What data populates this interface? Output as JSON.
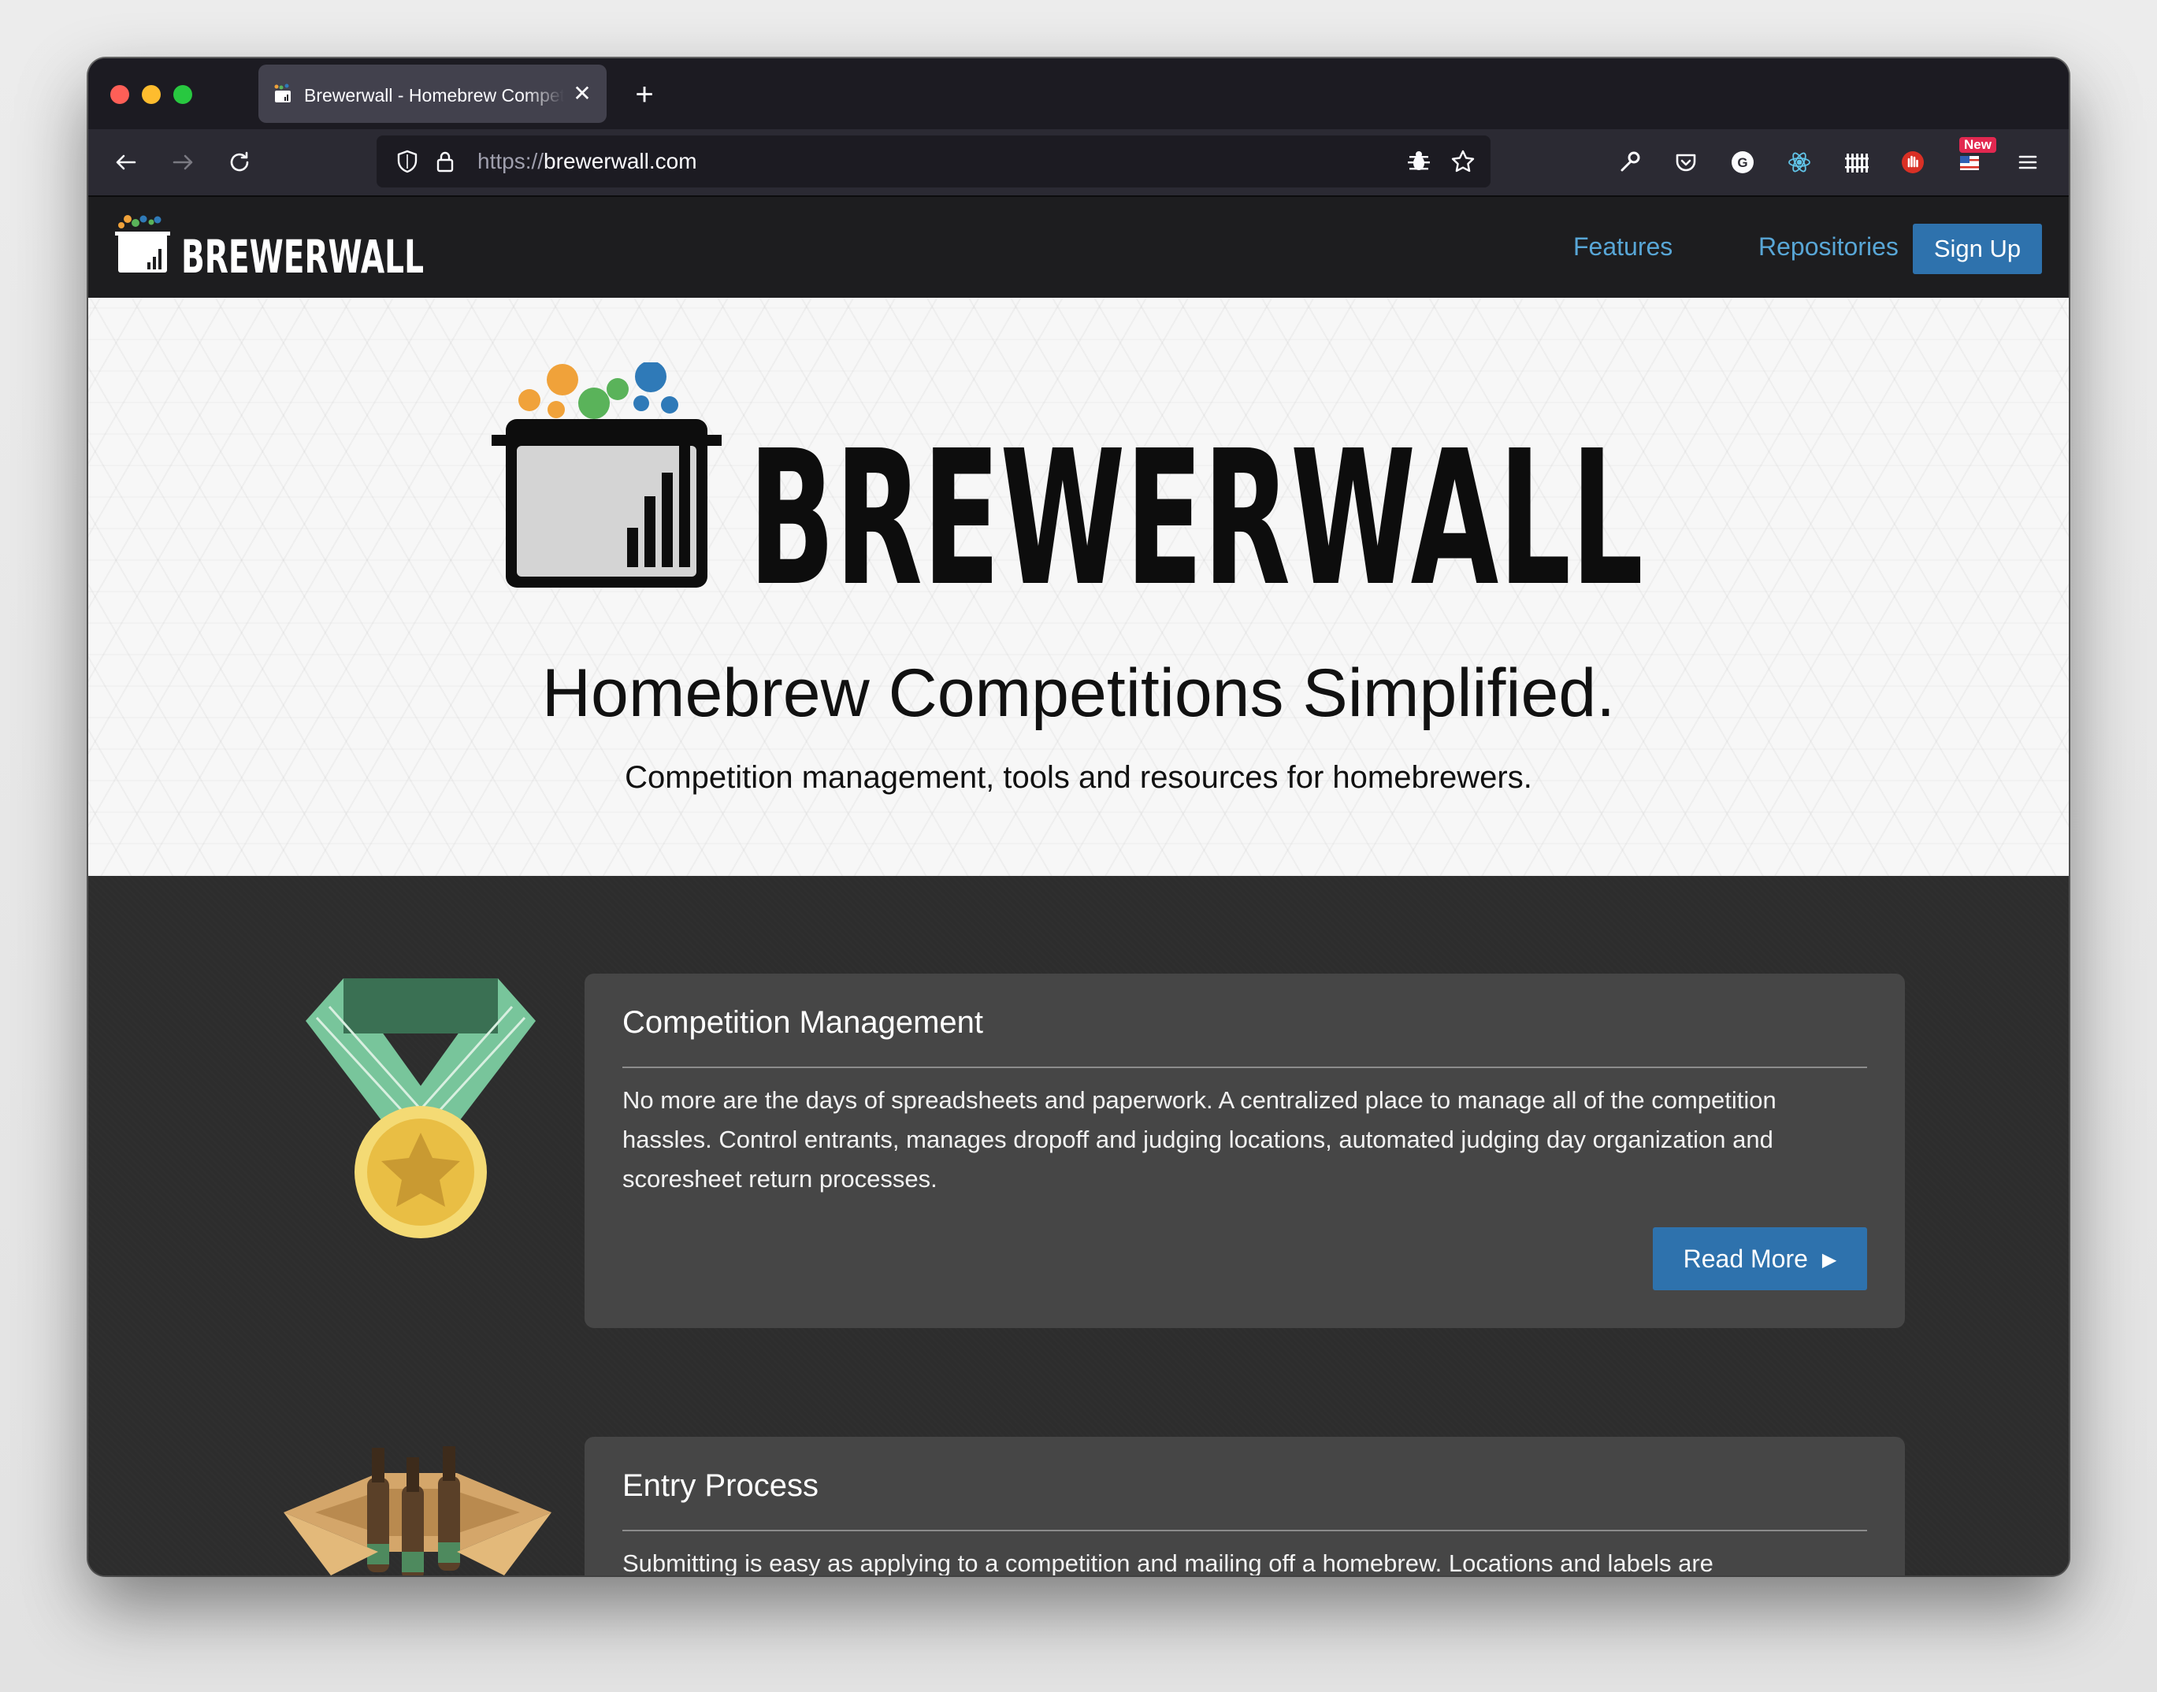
{
  "browser": {
    "tab_title": "Brewerwall - Homebrew Competitions Simplified",
    "tab_close": "✕",
    "new_tab": "+",
    "url_scheme": "https://",
    "url_host": "brewerwall.com",
    "extension_badge": "New",
    "icons": [
      "back-arrow-icon",
      "forward-arrow-icon",
      "reload-icon",
      "shield-icon",
      "lock-icon",
      "bug-icon",
      "star-icon",
      "wrench-icon",
      "pocket-icon",
      "grammarly-icon",
      "react-icon",
      "fence-icon",
      "hand-icon",
      "flag-icon",
      "hamburger-menu-icon"
    ]
  },
  "site": {
    "logo_text": "BREWERWALL",
    "nav": {
      "features": "Features",
      "repositories": "Repositories",
      "signup": "Sign Up"
    }
  },
  "hero": {
    "logo_text": "BREWERWALL",
    "title": "Homebrew Competitions Simplified.",
    "subtitle": "Competition management, tools and resources for homebrewers."
  },
  "features": [
    {
      "title": "Competition Management",
      "body": "No more are the days of spreadsheets and paperwork. A centralized place to manage all of the competition hassles. Control entrants, manages dropoff and judging locations, automated judging day organization and scoresheet return processes.",
      "button": "Read More",
      "icon": "medal-icon"
    },
    {
      "title": "Entry Process",
      "body": "Submitting is easy as applying to a competition and mailing off a homebrew. Locations and labels are",
      "icon": "beer-box-icon"
    }
  ],
  "colors": {
    "accent": "#2e72ad",
    "link": "#58a6d6",
    "nav_bg": "#1d1d1f",
    "card_bg": "#464646",
    "bubble_orange": "#f0a23a",
    "bubble_green": "#5ab35a",
    "bubble_blue": "#2f7ab8"
  }
}
